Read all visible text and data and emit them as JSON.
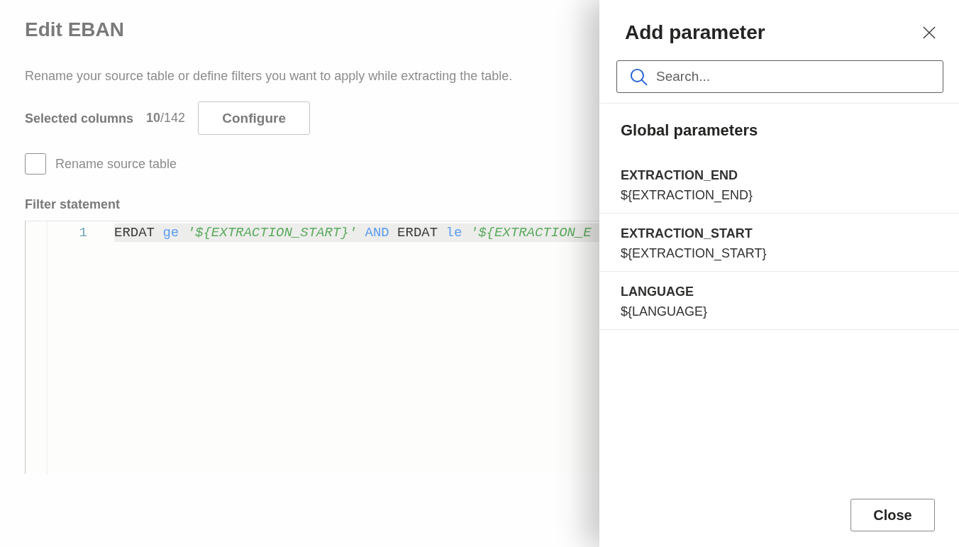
{
  "page": {
    "title": "Edit EBAN",
    "description": "Rename your source table or define filters you want to apply while extracting the table.",
    "selected_columns": {
      "label": "Selected columns",
      "count": "**10**/142"
    },
    "configure_button": "Configure",
    "rename_checkbox": {
      "label": "Rename source table",
      "checked": false
    },
    "filter_statement": {
      "label": "Filter statement",
      "lines": [
        {
          "number": "1",
          "current": true,
          "tokens": [
            {
              "text": "ERDAT",
              "kind": "identifier"
            },
            {
              "text": "ge",
              "kind": "keyword"
            },
            {
              "text": "'${EXTRACTION_START}'",
              "kind": "string"
            },
            {
              "text": "AND",
              "kind": "keyword"
            },
            {
              "text": "ERDAT",
              "kind": "identifier"
            },
            {
              "text": "le",
              "kind": "keyword"
            },
            {
              "text": "'${EXTRACTION_E",
              "kind": "string"
            }
          ]
        }
      ]
    }
  },
  "panel": {
    "title": "Add parameter",
    "search": {
      "placeholder": "Search..."
    },
    "section_title": "Global parameters",
    "parameters": [
      {
        "name": "EXTRACTION_END",
        "value": "${EXTRACTION_END}"
      },
      {
        "name": "EXTRACTION_START",
        "value": "${EXTRACTION_START}"
      },
      {
        "name": "LANGUAGE",
        "value": "${LANGUAGE}"
      }
    ],
    "close_button": "Close"
  }
}
